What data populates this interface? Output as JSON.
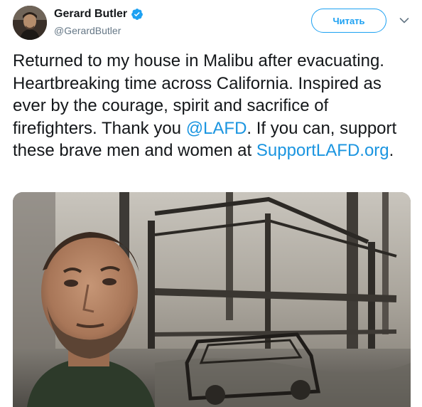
{
  "author": {
    "display_name": "Gerard Butler",
    "handle": "@GerardButler",
    "verified": true,
    "avatar_icon": "user-avatar"
  },
  "actions": {
    "follow_label": "Читать",
    "more_icon": "chevron-down-icon"
  },
  "tweet": {
    "text_part1": "Returned to my house in Malibu after evacuating. Heartbreaking time across California. Inspired as ever by the courage, spirit and sacrifice of firefighters. Thank you ",
    "mention": "@LAFD",
    "text_part2": ". If you can, support these brave men and women at ",
    "link": "SupportLAFD.org",
    "text_part3": "."
  },
  "media": {
    "kind": "photo"
  },
  "colors": {
    "accent": "#1da1f2",
    "link": "#1b95e0",
    "text": "#14171a",
    "secondary": "#657786"
  }
}
